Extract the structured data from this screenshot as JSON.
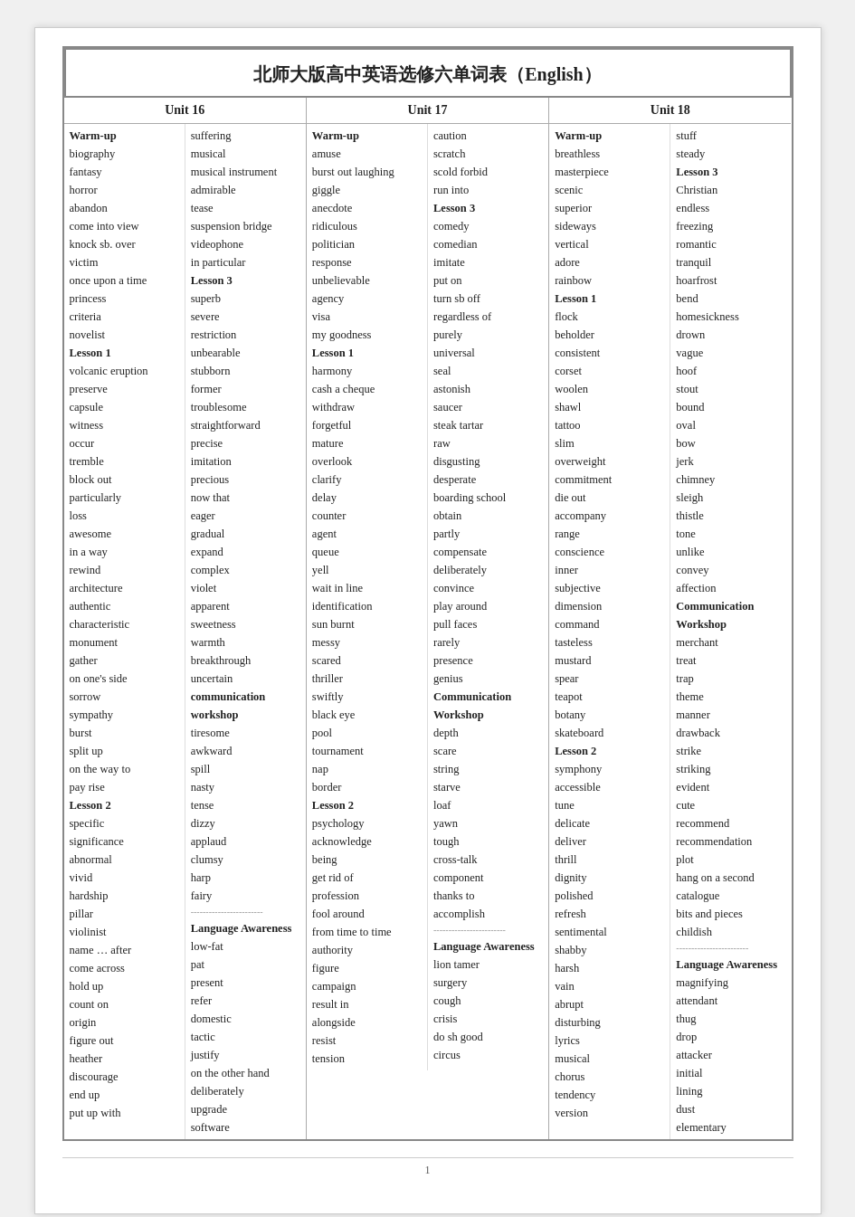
{
  "title": "北师大版高中英语选修六单词表（English）",
  "units": [
    {
      "label": "Unit 16",
      "col1": [
        {
          "text": "Warm-up",
          "bold": true
        },
        {
          "text": "biography"
        },
        {
          "text": "fantasy"
        },
        {
          "text": "horror"
        },
        {
          "text": "abandon"
        },
        {
          "text": "come into view"
        },
        {
          "text": "knock sb. over"
        },
        {
          "text": "victim"
        },
        {
          "text": "once upon a time"
        },
        {
          "text": "princess"
        },
        {
          "text": "criteria"
        },
        {
          "text": "novelist"
        },
        {
          "text": "Lesson 1",
          "bold": true
        },
        {
          "text": "volcanic eruption"
        },
        {
          "text": "preserve"
        },
        {
          "text": "capsule"
        },
        {
          "text": "witness"
        },
        {
          "text": "occur"
        },
        {
          "text": "tremble"
        },
        {
          "text": "block out"
        },
        {
          "text": "particularly"
        },
        {
          "text": "loss"
        },
        {
          "text": "awesome"
        },
        {
          "text": "in a way"
        },
        {
          "text": "rewind"
        },
        {
          "text": "architecture"
        },
        {
          "text": "authentic"
        },
        {
          "text": "characteristic"
        },
        {
          "text": "monument"
        },
        {
          "text": "gather"
        },
        {
          "text": "on one's side"
        },
        {
          "text": "sorrow"
        },
        {
          "text": "sympathy"
        },
        {
          "text": "burst"
        },
        {
          "text": "split up"
        },
        {
          "text": "on the way to"
        },
        {
          "text": "pay rise"
        },
        {
          "text": "Lesson 2",
          "bold": true
        },
        {
          "text": "specific"
        },
        {
          "text": "significance"
        },
        {
          "text": "abnormal"
        },
        {
          "text": "vivid"
        },
        {
          "text": "hardship"
        },
        {
          "text": "pillar"
        },
        {
          "text": "violinist"
        },
        {
          "text": "name … after"
        },
        {
          "text": "come across"
        },
        {
          "text": "hold up"
        },
        {
          "text": "count on"
        },
        {
          "text": "origin"
        },
        {
          "text": "figure out"
        },
        {
          "text": "heather"
        },
        {
          "text": "discourage"
        },
        {
          "text": "end up"
        },
        {
          "text": "put up with"
        }
      ],
      "col2": [
        {
          "text": "suffering"
        },
        {
          "text": "musical"
        },
        {
          "text": "musical instrument"
        },
        {
          "text": "admirable"
        },
        {
          "text": "tease"
        },
        {
          "text": "suspension bridge"
        },
        {
          "text": "videophone"
        },
        {
          "text": "in particular"
        },
        {
          "text": "Lesson 3",
          "bold": true
        },
        {
          "text": "superb"
        },
        {
          "text": "severe"
        },
        {
          "text": "restriction"
        },
        {
          "text": "unbearable"
        },
        {
          "text": "stubborn"
        },
        {
          "text": "former"
        },
        {
          "text": "troublesome"
        },
        {
          "text": "straightforward"
        },
        {
          "text": "precise"
        },
        {
          "text": "imitation"
        },
        {
          "text": "precious"
        },
        {
          "text": "now that"
        },
        {
          "text": "eager"
        },
        {
          "text": "gradual"
        },
        {
          "text": "expand"
        },
        {
          "text": "complex"
        },
        {
          "text": "violet"
        },
        {
          "text": "apparent"
        },
        {
          "text": "sweetness"
        },
        {
          "text": "warmth"
        },
        {
          "text": "breakthrough"
        },
        {
          "text": "uncertain"
        },
        {
          "text": "communication",
          "bold": true
        },
        {
          "text": "workshop",
          "bold": true
        },
        {
          "text": "tiresome"
        },
        {
          "text": "awkward"
        },
        {
          "text": "spill"
        },
        {
          "text": "nasty"
        },
        {
          "text": "tense"
        },
        {
          "text": "dizzy"
        },
        {
          "text": "applaud"
        },
        {
          "text": "clumsy"
        },
        {
          "text": "harp"
        },
        {
          "text": "fairy"
        },
        {
          "text": "divider"
        },
        {
          "text": "Language Awareness",
          "bold": true
        },
        {
          "text": "low-fat"
        },
        {
          "text": "pat"
        },
        {
          "text": "present"
        },
        {
          "text": "refer"
        },
        {
          "text": "domestic"
        },
        {
          "text": "tactic"
        },
        {
          "text": "justify"
        },
        {
          "text": "on the other hand"
        },
        {
          "text": "deliberately"
        },
        {
          "text": "upgrade"
        },
        {
          "text": "software"
        }
      ]
    },
    {
      "label": "Unit 17",
      "col1": [
        {
          "text": "Warm-up",
          "bold": true
        },
        {
          "text": "amuse"
        },
        {
          "text": "burst out laughing"
        },
        {
          "text": "giggle"
        },
        {
          "text": "anecdote"
        },
        {
          "text": "ridiculous"
        },
        {
          "text": "politician"
        },
        {
          "text": "response"
        },
        {
          "text": "unbelievable"
        },
        {
          "text": "agency"
        },
        {
          "text": "visa"
        },
        {
          "text": "my goodness"
        },
        {
          "text": "Lesson 1",
          "bold": true
        },
        {
          "text": "harmony"
        },
        {
          "text": "cash a cheque"
        },
        {
          "text": "withdraw"
        },
        {
          "text": "forgetful"
        },
        {
          "text": "mature"
        },
        {
          "text": "overlook"
        },
        {
          "text": "clarify"
        },
        {
          "text": "delay"
        },
        {
          "text": "counter"
        },
        {
          "text": "agent"
        },
        {
          "text": "queue"
        },
        {
          "text": "yell"
        },
        {
          "text": "wait in line"
        },
        {
          "text": "identification"
        },
        {
          "text": "sun burnt"
        },
        {
          "text": "messy"
        },
        {
          "text": "scared"
        },
        {
          "text": "thriller"
        },
        {
          "text": "swiftly"
        },
        {
          "text": "black eye"
        },
        {
          "text": "pool"
        },
        {
          "text": "tournament"
        },
        {
          "text": "nap"
        },
        {
          "text": "border"
        },
        {
          "text": "Lesson 2",
          "bold": true
        },
        {
          "text": "psychology"
        },
        {
          "text": "acknowledge"
        },
        {
          "text": "being"
        },
        {
          "text": "get rid of"
        },
        {
          "text": "profession"
        },
        {
          "text": "fool around"
        },
        {
          "text": "from time to time"
        },
        {
          "text": "authority"
        },
        {
          "text": "figure"
        },
        {
          "text": "campaign"
        },
        {
          "text": "result in"
        },
        {
          "text": "alongside"
        },
        {
          "text": "resist"
        },
        {
          "text": "tension"
        }
      ],
      "col2": [
        {
          "text": "caution"
        },
        {
          "text": "scratch"
        },
        {
          "text": "scold forbid"
        },
        {
          "text": "run into"
        },
        {
          "text": "Lesson 3",
          "bold": true
        },
        {
          "text": "comedy"
        },
        {
          "text": "comedian"
        },
        {
          "text": "imitate"
        },
        {
          "text": "put on"
        },
        {
          "text": "turn sb off"
        },
        {
          "text": "regardless of"
        },
        {
          "text": "purely"
        },
        {
          "text": "universal"
        },
        {
          "text": "seal"
        },
        {
          "text": "astonish"
        },
        {
          "text": "saucer"
        },
        {
          "text": "steak tartar"
        },
        {
          "text": "raw"
        },
        {
          "text": "disgusting"
        },
        {
          "text": "desperate"
        },
        {
          "text": "boarding school"
        },
        {
          "text": "obtain"
        },
        {
          "text": "partly"
        },
        {
          "text": "compensate"
        },
        {
          "text": "deliberately"
        },
        {
          "text": "convince"
        },
        {
          "text": "play around"
        },
        {
          "text": "pull faces"
        },
        {
          "text": "rarely"
        },
        {
          "text": "presence"
        },
        {
          "text": "genius"
        },
        {
          "text": "Communication",
          "bold": true
        },
        {
          "text": "Workshop",
          "bold": true
        },
        {
          "text": "depth"
        },
        {
          "text": "scare"
        },
        {
          "text": "string"
        },
        {
          "text": "starve"
        },
        {
          "text": "loaf"
        },
        {
          "text": "yawn"
        },
        {
          "text": "tough"
        },
        {
          "text": "cross-talk"
        },
        {
          "text": "component"
        },
        {
          "text": "thanks to"
        },
        {
          "text": "accomplish"
        },
        {
          "text": "divider"
        },
        {
          "text": "Language Awareness",
          "bold": true
        },
        {
          "text": "lion tamer"
        },
        {
          "text": "surgery"
        },
        {
          "text": "cough"
        },
        {
          "text": "crisis"
        },
        {
          "text": "do sh good"
        },
        {
          "text": "circus"
        }
      ]
    },
    {
      "label": "Unit 18",
      "col1": [
        {
          "text": "Warm-up",
          "bold": true
        },
        {
          "text": "breathless"
        },
        {
          "text": "masterpiece"
        },
        {
          "text": "scenic"
        },
        {
          "text": "superior"
        },
        {
          "text": "sideways"
        },
        {
          "text": "vertical"
        },
        {
          "text": "adore"
        },
        {
          "text": "rainbow"
        },
        {
          "text": "Lesson 1",
          "bold": true
        },
        {
          "text": "flock"
        },
        {
          "text": "beholder"
        },
        {
          "text": "consistent"
        },
        {
          "text": "corset"
        },
        {
          "text": "woolen"
        },
        {
          "text": "shawl"
        },
        {
          "text": "tattoo"
        },
        {
          "text": "slim"
        },
        {
          "text": "overweight"
        },
        {
          "text": "commitment"
        },
        {
          "text": "die out"
        },
        {
          "text": "accompany"
        },
        {
          "text": "range"
        },
        {
          "text": "conscience"
        },
        {
          "text": "inner"
        },
        {
          "text": "subjective"
        },
        {
          "text": "dimension"
        },
        {
          "text": "command"
        },
        {
          "text": "tasteless"
        },
        {
          "text": "mustard"
        },
        {
          "text": "spear"
        },
        {
          "text": "teapot"
        },
        {
          "text": "botany"
        },
        {
          "text": "skateboard"
        },
        {
          "text": "Lesson 2",
          "bold": true
        },
        {
          "text": "symphony"
        },
        {
          "text": "accessible"
        },
        {
          "text": "tune"
        },
        {
          "text": "delicate"
        },
        {
          "text": "deliver"
        },
        {
          "text": "thrill"
        },
        {
          "text": "dignity"
        },
        {
          "text": "polished"
        },
        {
          "text": "refresh"
        },
        {
          "text": "sentimental"
        },
        {
          "text": "shabby"
        },
        {
          "text": "harsh"
        },
        {
          "text": "vain"
        },
        {
          "text": "abrupt"
        },
        {
          "text": "disturbing"
        },
        {
          "text": "lyrics"
        },
        {
          "text": "musical"
        },
        {
          "text": "chorus"
        },
        {
          "text": "tendency"
        },
        {
          "text": "version"
        }
      ],
      "col2": [
        {
          "text": "stuff"
        },
        {
          "text": "steady"
        },
        {
          "text": "Lesson 3",
          "bold": true
        },
        {
          "text": "Christian"
        },
        {
          "text": "endless"
        },
        {
          "text": "freezing"
        },
        {
          "text": "romantic"
        },
        {
          "text": "tranquil"
        },
        {
          "text": "hoarfrost"
        },
        {
          "text": "bend"
        },
        {
          "text": "homesickness"
        },
        {
          "text": "drown"
        },
        {
          "text": "vague"
        },
        {
          "text": "hoof"
        },
        {
          "text": "stout"
        },
        {
          "text": "bound"
        },
        {
          "text": "oval"
        },
        {
          "text": "bow"
        },
        {
          "text": "jerk"
        },
        {
          "text": "chimney"
        },
        {
          "text": "sleigh"
        },
        {
          "text": "thistle"
        },
        {
          "text": "tone"
        },
        {
          "text": "unlike"
        },
        {
          "text": "convey"
        },
        {
          "text": "affection"
        },
        {
          "text": "Communication",
          "bold": true
        },
        {
          "text": "Workshop",
          "bold": true
        },
        {
          "text": "merchant"
        },
        {
          "text": "treat"
        },
        {
          "text": "trap"
        },
        {
          "text": "theme"
        },
        {
          "text": "manner"
        },
        {
          "text": "drawback"
        },
        {
          "text": "strike"
        },
        {
          "text": "striking"
        },
        {
          "text": "evident"
        },
        {
          "text": "cute"
        },
        {
          "text": "recommend"
        },
        {
          "text": "recommendation"
        },
        {
          "text": "plot"
        },
        {
          "text": "hang on a second"
        },
        {
          "text": "catalogue"
        },
        {
          "text": "bits and pieces"
        },
        {
          "text": "childish"
        },
        {
          "text": "divider"
        },
        {
          "text": "Language Awareness",
          "bold": true
        },
        {
          "text": "magnifying"
        },
        {
          "text": "attendant"
        },
        {
          "text": "thug"
        },
        {
          "text": "drop"
        },
        {
          "text": "attacker"
        },
        {
          "text": "initial"
        },
        {
          "text": "lining"
        },
        {
          "text": "dust"
        },
        {
          "text": "elementary"
        }
      ]
    }
  ],
  "footer": "1"
}
